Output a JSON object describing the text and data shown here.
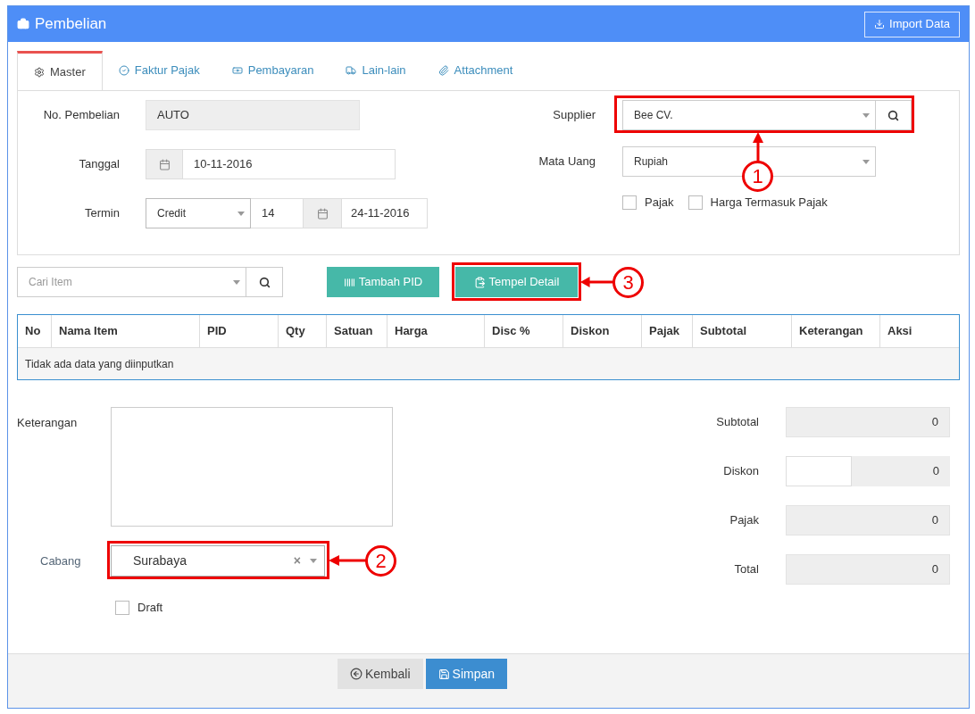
{
  "header": {
    "title": "Pembelian",
    "import_button": "Import Data"
  },
  "tabs": [
    {
      "label": "Master",
      "selected": true
    },
    {
      "label": "Faktur Pajak",
      "selected": false
    },
    {
      "label": "Pembayaran",
      "selected": false
    },
    {
      "label": "Lain-lain",
      "selected": false
    },
    {
      "label": "Attachment",
      "selected": false
    }
  ],
  "master": {
    "no_pembelian": {
      "label": "No. Pembelian",
      "value": "AUTO"
    },
    "tanggal": {
      "label": "Tanggal",
      "value": "10-11-2016"
    },
    "termin": {
      "label": "Termin",
      "type": "Credit",
      "days": "14",
      "due_date": "24-11-2016"
    },
    "supplier": {
      "label": "Supplier",
      "value": "Bee CV."
    },
    "mata_uang": {
      "label": "Mata Uang",
      "value": "Rupiah"
    },
    "checkboxes": [
      {
        "label": "Pajak",
        "checked": false
      },
      {
        "label": "Harga Termasuk Pajak",
        "checked": false
      }
    ]
  },
  "toolbar": {
    "search": {
      "placeholder": "Cari Item"
    },
    "buttons": [
      {
        "label": "Tambah PID"
      },
      {
        "label": "Tempel Detail"
      }
    ]
  },
  "table": {
    "columns": [
      "No",
      "Nama Item",
      "PID",
      "Qty",
      "Satuan",
      "Harga",
      "Disc %",
      "Diskon",
      "Pajak",
      "Subtotal",
      "Keterangan",
      "Aksi"
    ],
    "empty_message": "Tidak ada data yang diinputkan"
  },
  "notes": {
    "label": "Keterangan"
  },
  "cabang": {
    "label": "Cabang",
    "value": "Surabaya",
    "clear": "×"
  },
  "draft": {
    "label": "Draft",
    "checked": false
  },
  "totals": [
    {
      "label": "Subtotal",
      "value": "0",
      "kind": "plain"
    },
    {
      "label": "Diskon",
      "value": "0",
      "kind": "split"
    },
    {
      "label": "Pajak",
      "value": "0",
      "kind": "plain"
    },
    {
      "label": "Total",
      "value": "0",
      "kind": "plain"
    }
  ],
  "footer": {
    "buttons": [
      {
        "label": "Kembali",
        "kind": "back"
      },
      {
        "label": "Simpan",
        "kind": "save"
      }
    ]
  },
  "annotations": [
    {
      "number": "1"
    },
    {
      "number": "2"
    },
    {
      "number": "3"
    }
  ]
}
